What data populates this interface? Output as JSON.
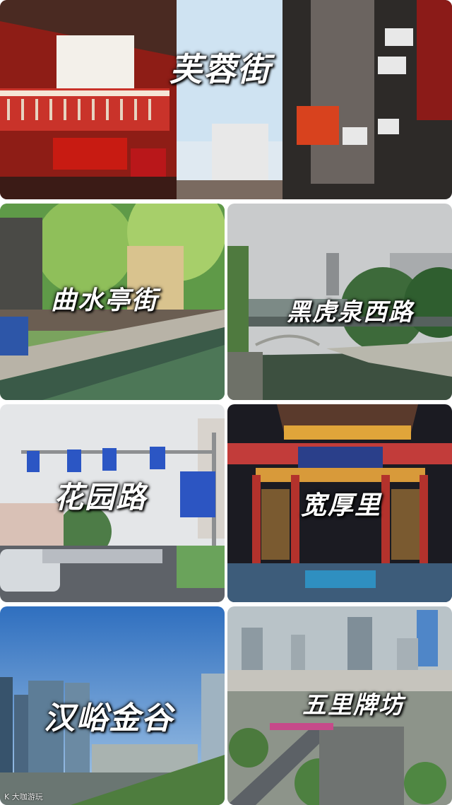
{
  "photos": [
    {
      "caption": "芙蓉街",
      "scene": "old shopping street with red wooden buildings"
    },
    {
      "caption": "曲水亭街",
      "scene": "canal lined with willow trees and cafe seating"
    },
    {
      "caption": "黑虎泉西路",
      "scene": "moat river with stone railings"
    },
    {
      "caption": "花园路",
      "scene": "city road with blue traffic signs"
    },
    {
      "caption": "宽厚里",
      "scene": "illuminated traditional gate at night"
    },
    {
      "caption": "汉峪金谷",
      "scene": "modern glass office towers"
    },
    {
      "caption": "五里牌坊",
      "scene": "aerial city view with skyscrapers"
    }
  ],
  "watermark": "K 大咖游玩",
  "colors": {
    "sky": "#cfe3f2",
    "red": "#b8241c",
    "green": "#3f7a3a",
    "water": "#3a5a48"
  }
}
